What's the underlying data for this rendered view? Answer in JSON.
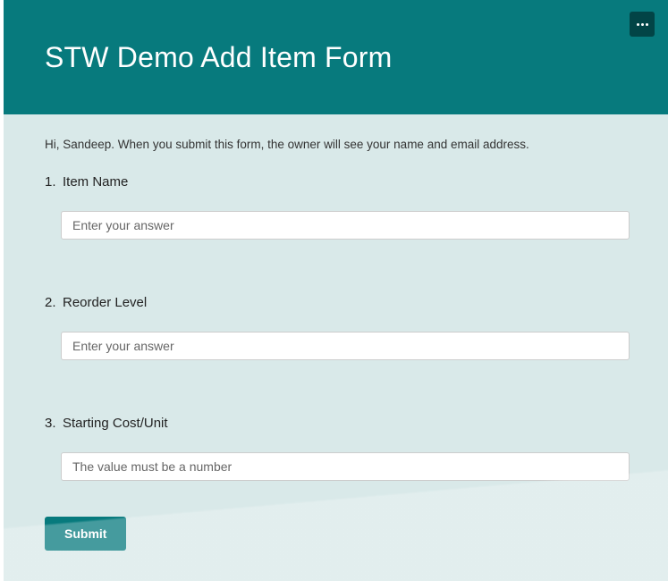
{
  "header": {
    "title": "STW Demo Add Item Form"
  },
  "intro": {
    "text": "Hi, Sandeep. When you submit this form, the owner will see your name and email address."
  },
  "questions": [
    {
      "number": "1.",
      "label": "Item Name",
      "placeholder": "Enter your answer"
    },
    {
      "number": "2.",
      "label": "Reorder Level",
      "placeholder": "Enter your answer"
    },
    {
      "number": "3.",
      "label": "Starting Cost/Unit",
      "placeholder": "The value must be a number"
    }
  ],
  "submit": {
    "label": "Submit"
  }
}
